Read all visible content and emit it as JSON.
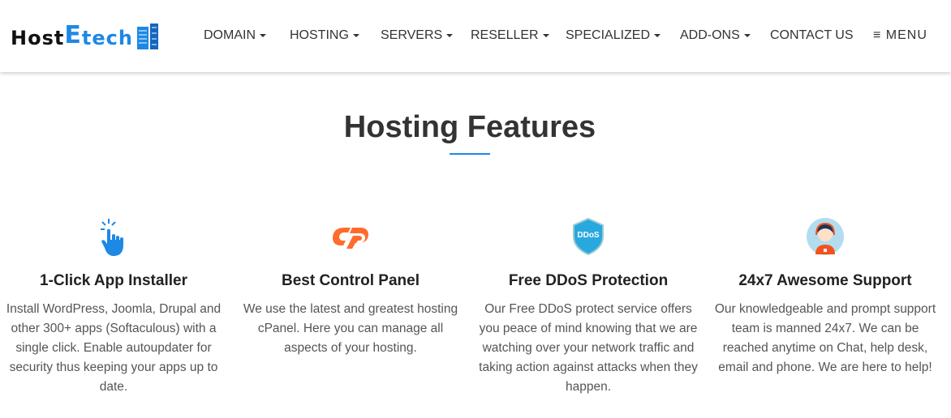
{
  "logo": {
    "part1": "Host",
    "part2": "E",
    "part3": "tech"
  },
  "nav": [
    {
      "label": "DOMAIN",
      "caret": true
    },
    {
      "label": "HOSTING",
      "caret": true
    },
    {
      "label": "SERVERS",
      "caret": true
    },
    {
      "label": "RESELLER",
      "caret": true
    },
    {
      "label": "SPECIALIZED",
      "caret": true
    },
    {
      "label": "ADD-ONS",
      "caret": true
    },
    {
      "label": "CONTACT US",
      "caret": false
    }
  ],
  "menu_label": "MENU",
  "title": "Hosting Features",
  "accent": "#1e88e5",
  "features": [
    {
      "icon": "click-hand-icon",
      "title": "1-Click App Installer",
      "text": "Install WordPress, Joomla, Drupal and other 300+ apps (Softaculous) with a single click. Enable autoupdater for security thus keeping your apps up to date."
    },
    {
      "icon": "cpanel-icon",
      "title": "Best Control Panel",
      "text": "We use the latest and greatest hosting cPanel. Here you can manage all aspects of your hosting."
    },
    {
      "icon": "ddos-shield-icon",
      "title": "Free DDoS Protection",
      "badge": "DDoS",
      "text": "Our Free DDoS protect service offers you peace of mind knowing that we are watching over your network traffic and taking action against attacks when they happen."
    },
    {
      "icon": "support-agent-icon",
      "title": "24x7 Awesome Support",
      "text": "Our knowledgeable and prompt support team is manned 24x7. We can be reached anytime on Chat, help desk, email and phone. We are here to help!"
    }
  ]
}
